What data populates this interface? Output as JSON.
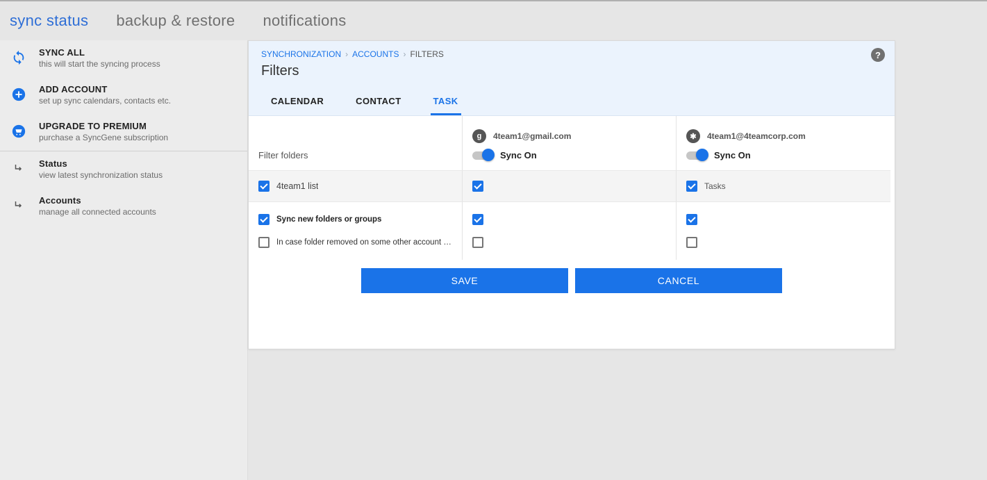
{
  "topTabs": {
    "sync_status": "sync status",
    "backup_restore": "backup & restore",
    "notifications": "notifications"
  },
  "sidebar": {
    "sync_all": {
      "title": "SYNC ALL",
      "sub": "this will start the syncing process"
    },
    "add_account": {
      "title": "ADD ACCOUNT",
      "sub": "set up sync calendars, contacts etc."
    },
    "upgrade": {
      "title": "UPGRADE TO PREMIUM",
      "sub": "purchase a SyncGene subscription"
    },
    "status": {
      "title": "Status",
      "sub": "view latest synchronization status"
    },
    "accounts": {
      "title": "Accounts",
      "sub": "manage all connected accounts"
    }
  },
  "breadcrumb": {
    "synchronization": "SYNCHRONIZATION",
    "accounts": "ACCOUNTS",
    "filters": "FILTERS"
  },
  "page_title": "Filters",
  "help_char": "?",
  "subtabs": {
    "calendar": "CALENDAR",
    "contact": "CONTACT",
    "task": "TASK"
  },
  "filter_folders_label": "Filter folders",
  "accounts": [
    {
      "email": "4team1@gmail.com",
      "icon_text": "g",
      "sync_label": "Sync On"
    },
    {
      "email": "4team1@4teamcorp.com",
      "icon_text": "✱",
      "sync_label": "Sync On"
    }
  ],
  "rows": {
    "list_name": "4team1 list",
    "tasks_cell": "Tasks",
    "sync_new": "Sync new folders or groups",
    "delete_removed": "In case folder removed on some other account - delete i..."
  },
  "buttons": {
    "save": "SAVE",
    "cancel": "CANCEL"
  }
}
